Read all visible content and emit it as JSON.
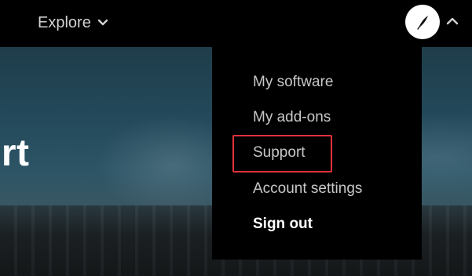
{
  "header": {
    "explore_label": "Explore"
  },
  "hero": {
    "title_fragment": "ort"
  },
  "account_menu": {
    "items": [
      {
        "label": "My software",
        "style": "normal"
      },
      {
        "label": "My add-ons",
        "style": "normal"
      },
      {
        "label": "Support",
        "style": "normal",
        "highlighted": true
      },
      {
        "label": "Account settings",
        "style": "normal"
      },
      {
        "label": "Sign out",
        "style": "bold"
      }
    ]
  },
  "colors": {
    "highlight_border": "#e0313c",
    "menu_background": "#000000",
    "menu_text": "#c8c8c8"
  },
  "icons": {
    "explore_chevron": "chevron-down-icon",
    "avatar": "quill-icon",
    "account_chevron": "chevron-up-icon"
  }
}
